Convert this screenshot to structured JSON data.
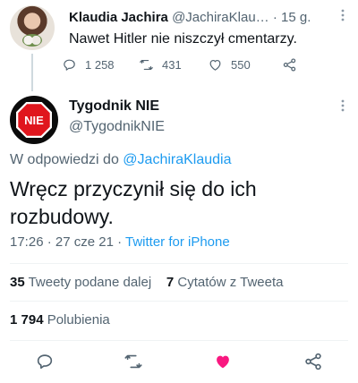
{
  "parent_tweet": {
    "display_name": "Klaudia Jachira",
    "handle": "@JachiraKlau…",
    "time_ago": "· 15 g.",
    "text": "Nawet Hitler nie niszczył cmentarzy.",
    "replies": "1 258",
    "retweets": "431",
    "likes": "550"
  },
  "main_tweet": {
    "display_name": "Tygodnik NIE",
    "handle": "@TygodnikNIE",
    "avatar_text": "NIE",
    "reply_prefix": "W odpowiedzi do ",
    "reply_mention": "@JachiraKlaudia",
    "text": "Wręcz przyczynił się do ich rozbudowy.",
    "time": "17:26 · 27 cze 21 · ",
    "source": "Twitter for iPhone",
    "retweets_count": "35",
    "retweets_label": " Tweety podane dalej",
    "quotes_count": "7",
    "quotes_label": " Cytatów z Tweeta",
    "likes_count": "1 794",
    "likes_label": " Polubienia",
    "liked": true
  },
  "colors": {
    "accent": "#1d9bf0",
    "like": "#f91880",
    "secondary_text": "#536471",
    "divider": "#eff3f4"
  },
  "icons": {
    "reply": "reply-icon",
    "retweet": "retweet-icon",
    "like": "heart-icon",
    "share": "share-icon",
    "more": "more-vertical-icon"
  }
}
